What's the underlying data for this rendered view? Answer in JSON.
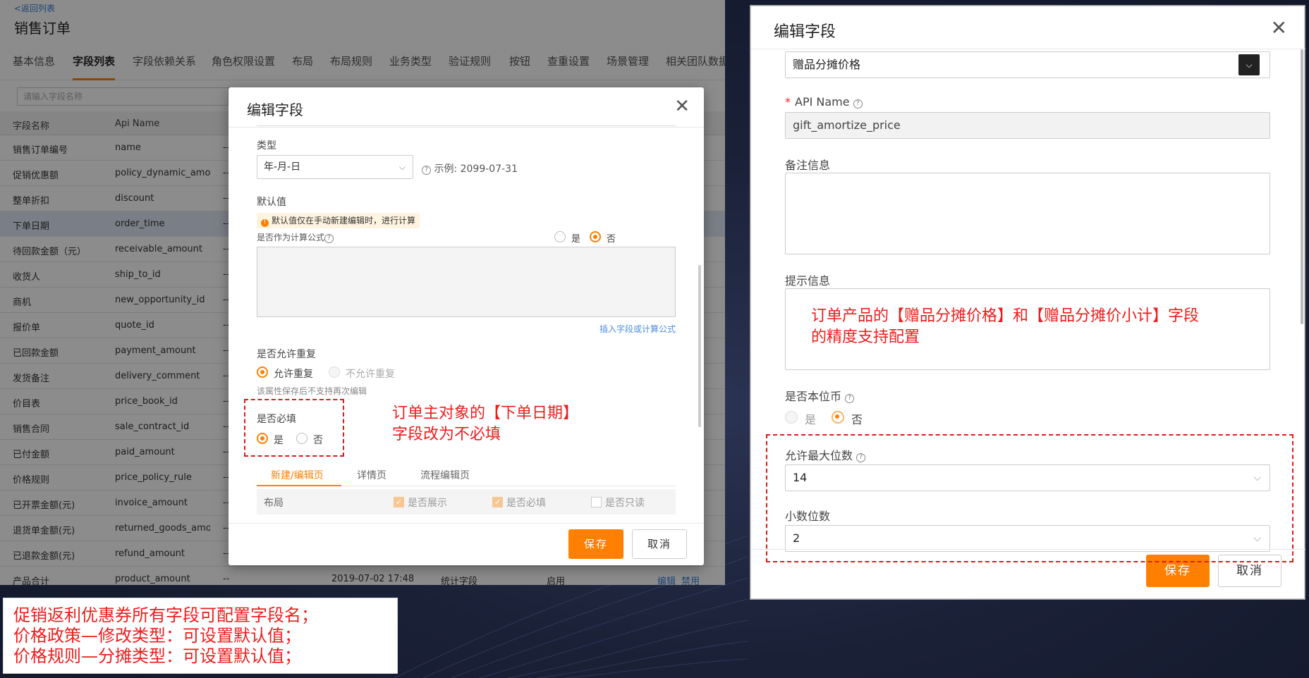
{
  "left_page": {
    "back_link": "<返回列表",
    "title": "销售订单",
    "tabs": [
      "基本信息",
      "字段列表",
      "字段依赖关系",
      "角色权限设置",
      "布局",
      "布局规则",
      "业务类型",
      "验证规则",
      "按钮",
      "查重设置",
      "场景管理",
      "相关团队数据"
    ],
    "active_tab": "字段列表",
    "search_placeholder": "请输入字段名称",
    "columns": {
      "name": "字段名称",
      "api": "Api Name"
    },
    "rows": [
      {
        "name": "销售订单编号",
        "api": "name",
        "dash": "--"
      },
      {
        "name": "促销优惠额",
        "api": "policy_dynamic_amo...",
        "dash": "--"
      },
      {
        "name": "整单折扣",
        "api": "discount",
        "dash": "--"
      },
      {
        "name": "下单日期",
        "api": "order_time",
        "dash": "--"
      },
      {
        "name": "待回款金额（元）",
        "api": "receivable_amount",
        "dash": "--"
      },
      {
        "name": "收货人",
        "api": "ship_to_id",
        "dash": "--"
      },
      {
        "name": "商机",
        "api": "new_opportunity_id",
        "dash": "--"
      },
      {
        "name": "报价单",
        "api": "quote_id",
        "dash": "--"
      },
      {
        "name": "已回款金额",
        "api": "payment_amount",
        "dash": "--"
      },
      {
        "name": "发货备注",
        "api": "delivery_comment",
        "dash": "--"
      },
      {
        "name": "价目表",
        "api": "price_book_id",
        "dash": "--"
      },
      {
        "name": "销售合同",
        "api": "sale_contract_id",
        "dash": "--"
      },
      {
        "name": "已付金额",
        "api": "paid_amount",
        "dash": "--"
      },
      {
        "name": "价格规则",
        "api": "price_policy_rule",
        "dash": "--"
      },
      {
        "name": "已开票金额(元)",
        "api": "invoice_amount",
        "dash": "--"
      },
      {
        "name": "退货单金额(元)",
        "api": "returned_goods_amo...",
        "dash": "--"
      },
      {
        "name": "已退款金额(元)",
        "api": "refund_amount",
        "dash": "--"
      },
      {
        "name": "产品合计",
        "api": "product_amount",
        "dash": "--",
        "date": "2019-07-02 17:48",
        "type": "统计字段",
        "status": "启用",
        "edit": "编辑",
        "disable": "禁用"
      }
    ],
    "modal": {
      "title": "编辑字段",
      "type_label": "类型",
      "type_value": "年-月-日",
      "example": "示例: 2099-07-31",
      "default_label": "默认值",
      "default_tip": "默认值仅在手动新建编辑时，进行计算",
      "formula_question": "是否作为计算公式",
      "yes": "是",
      "no": "否",
      "insert_link": "插入字段或计算公式",
      "dup_label": "是否允许重复",
      "allow_dup": "允许重复",
      "disallow_dup": "不允许重复",
      "dup_hint": "该属性保存后不支持再次编辑",
      "required_label": "是否必填",
      "subtabs": [
        "新建/编辑页",
        "详情页",
        "流程编辑页"
      ],
      "layout_label": "布局",
      "cb_show": "是否展示",
      "cb_required": "是否必填",
      "cb_readonly": "是否只读",
      "save": "保存",
      "cancel": "取消"
    },
    "annotation": [
      "订单主对象的【下单日期】",
      "字段改为不必填"
    ]
  },
  "note": [
    "促销返利优惠券所有字段可配置字段名；",
    "价格政策—修改类型：可设置默认值；",
    "价格规则—分摊类型：可设置默认值；"
  ],
  "right_modal": {
    "title": "编辑字段",
    "field_name_value": "赠品分摊价格",
    "api_label": "API Name",
    "api_value": "gift_amortize_price",
    "remark_label": "备注信息",
    "hint_label": "提示信息",
    "annotation": [
      "订单产品的【赠品分摊价格】和【赠品分摊价小计】字段",
      "的精度支持配置"
    ],
    "local_currency_label": "是否本位币",
    "yes": "是",
    "no": "否",
    "max_digits_label": "允许最大位数",
    "max_digits_value": "14",
    "decimal_label": "小数位数",
    "decimal_value": "2",
    "save": "保存",
    "cancel": "取消"
  },
  "colors": {
    "accent": "#ff8000",
    "annotation_red": "#ee1c1c",
    "link_blue": "#3a7bd5"
  }
}
